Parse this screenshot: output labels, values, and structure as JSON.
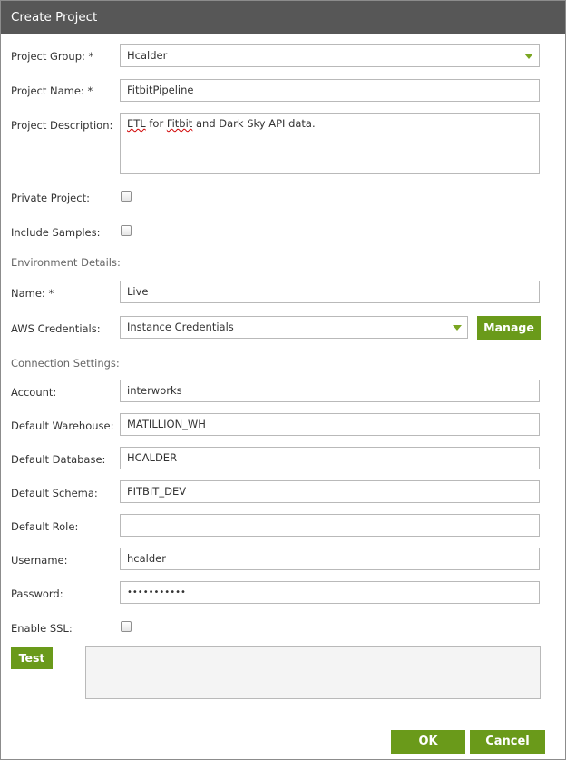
{
  "dialog": {
    "title": "Create Project"
  },
  "project": {
    "group_label": "Project Group: *",
    "group_value": "Hcalder",
    "name_label": "Project Name: *",
    "name_value": "FitbitPipeline",
    "description_label": "Project Description:",
    "description_word1": "ETL",
    "description_word2": " for ",
    "description_word3": "Fitbit",
    "description_rest": " and Dark Sky API data.",
    "private_label": "Private Project:",
    "private_checked": false,
    "samples_label": "Include Samples:",
    "samples_checked": false
  },
  "environment": {
    "section_label": "Environment Details:",
    "name_label": "Name: *",
    "name_value": "Live",
    "aws_label": "AWS Credentials:",
    "aws_value": "Instance Credentials",
    "manage_label": "Manage"
  },
  "connection": {
    "section_label": "Connection Settings:",
    "account_label": "Account:",
    "account_value": "interworks",
    "warehouse_label": "Default Warehouse:",
    "warehouse_value": "MATILLION_WH",
    "database_label": "Default Database:",
    "database_value": "HCALDER",
    "schema_label": "Default Schema:",
    "schema_value": "FITBIT_DEV",
    "role_label": "Default Role:",
    "role_value": "",
    "username_label": "Username:",
    "username_value": "hcalder",
    "password_label": "Password:",
    "password_value": "•••••••••••",
    "ssl_label": "Enable SSL:",
    "ssl_checked": false
  },
  "actions": {
    "test_label": "Test",
    "ok_label": "OK",
    "cancel_label": "Cancel"
  },
  "colors": {
    "title_bar": "#575757",
    "accent_green": "#6a9a1a",
    "dropdown_arrow": "#7aa621"
  }
}
